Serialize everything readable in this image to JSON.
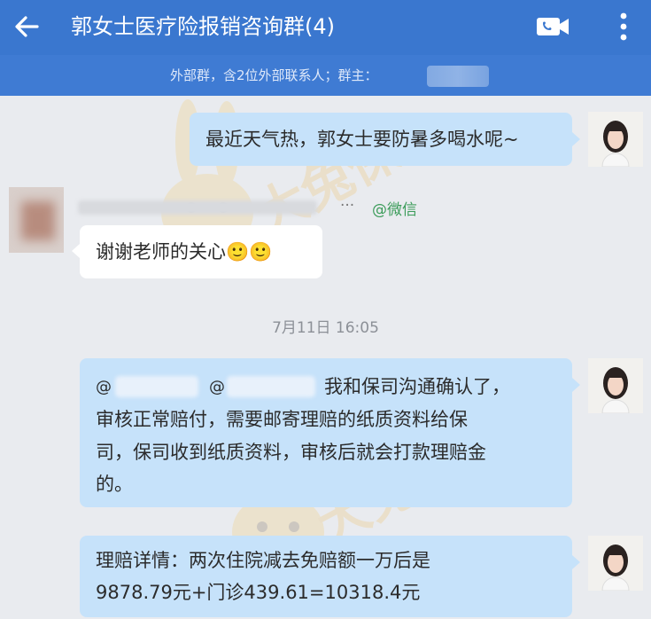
{
  "header": {
    "title": "郭女士医疗险报销咨询群(4)",
    "subtitle": "外部群，含2位外部联系人；群主：",
    "back_icon": "arrow-left-icon",
    "video_icon": "video-call-icon",
    "more_icon": "more-vertical-icon"
  },
  "watermark": {
    "brand": "大兔保"
  },
  "messages": [
    {
      "from": "agent",
      "lines": [
        "最近天气热，郭女士要防暑多喝水呢~"
      ]
    },
    {
      "from": "customer",
      "sender_suffix": "@微信",
      "ellipsis": "···",
      "lines": [
        "谢谢老师的关心🙂🙂"
      ]
    },
    {
      "type": "time",
      "text": "7月11日  16:05"
    },
    {
      "from": "agent",
      "mentions": [
        "@",
        "@"
      ],
      "lines": [
        "我和保司沟通确认了，",
        "审核正常赔付，需要邮寄理赔的纸质资料给保",
        "司，保司收到纸质资料，审核后就会打款理赔金",
        "的。"
      ]
    },
    {
      "from": "agent",
      "lines": [
        "理赔详情：两次住院减去免赔额一万后是",
        "9878.79元+门诊439.61=10318.4元"
      ]
    }
  ],
  "colors": {
    "header": "#3a77cf",
    "subheader": "#3f7bd3",
    "agent_bubble": "#c6e2fa",
    "customer_bubble": "#ffffff",
    "background": "#e9ebef",
    "wechat_tag": "#3c9c5a"
  }
}
